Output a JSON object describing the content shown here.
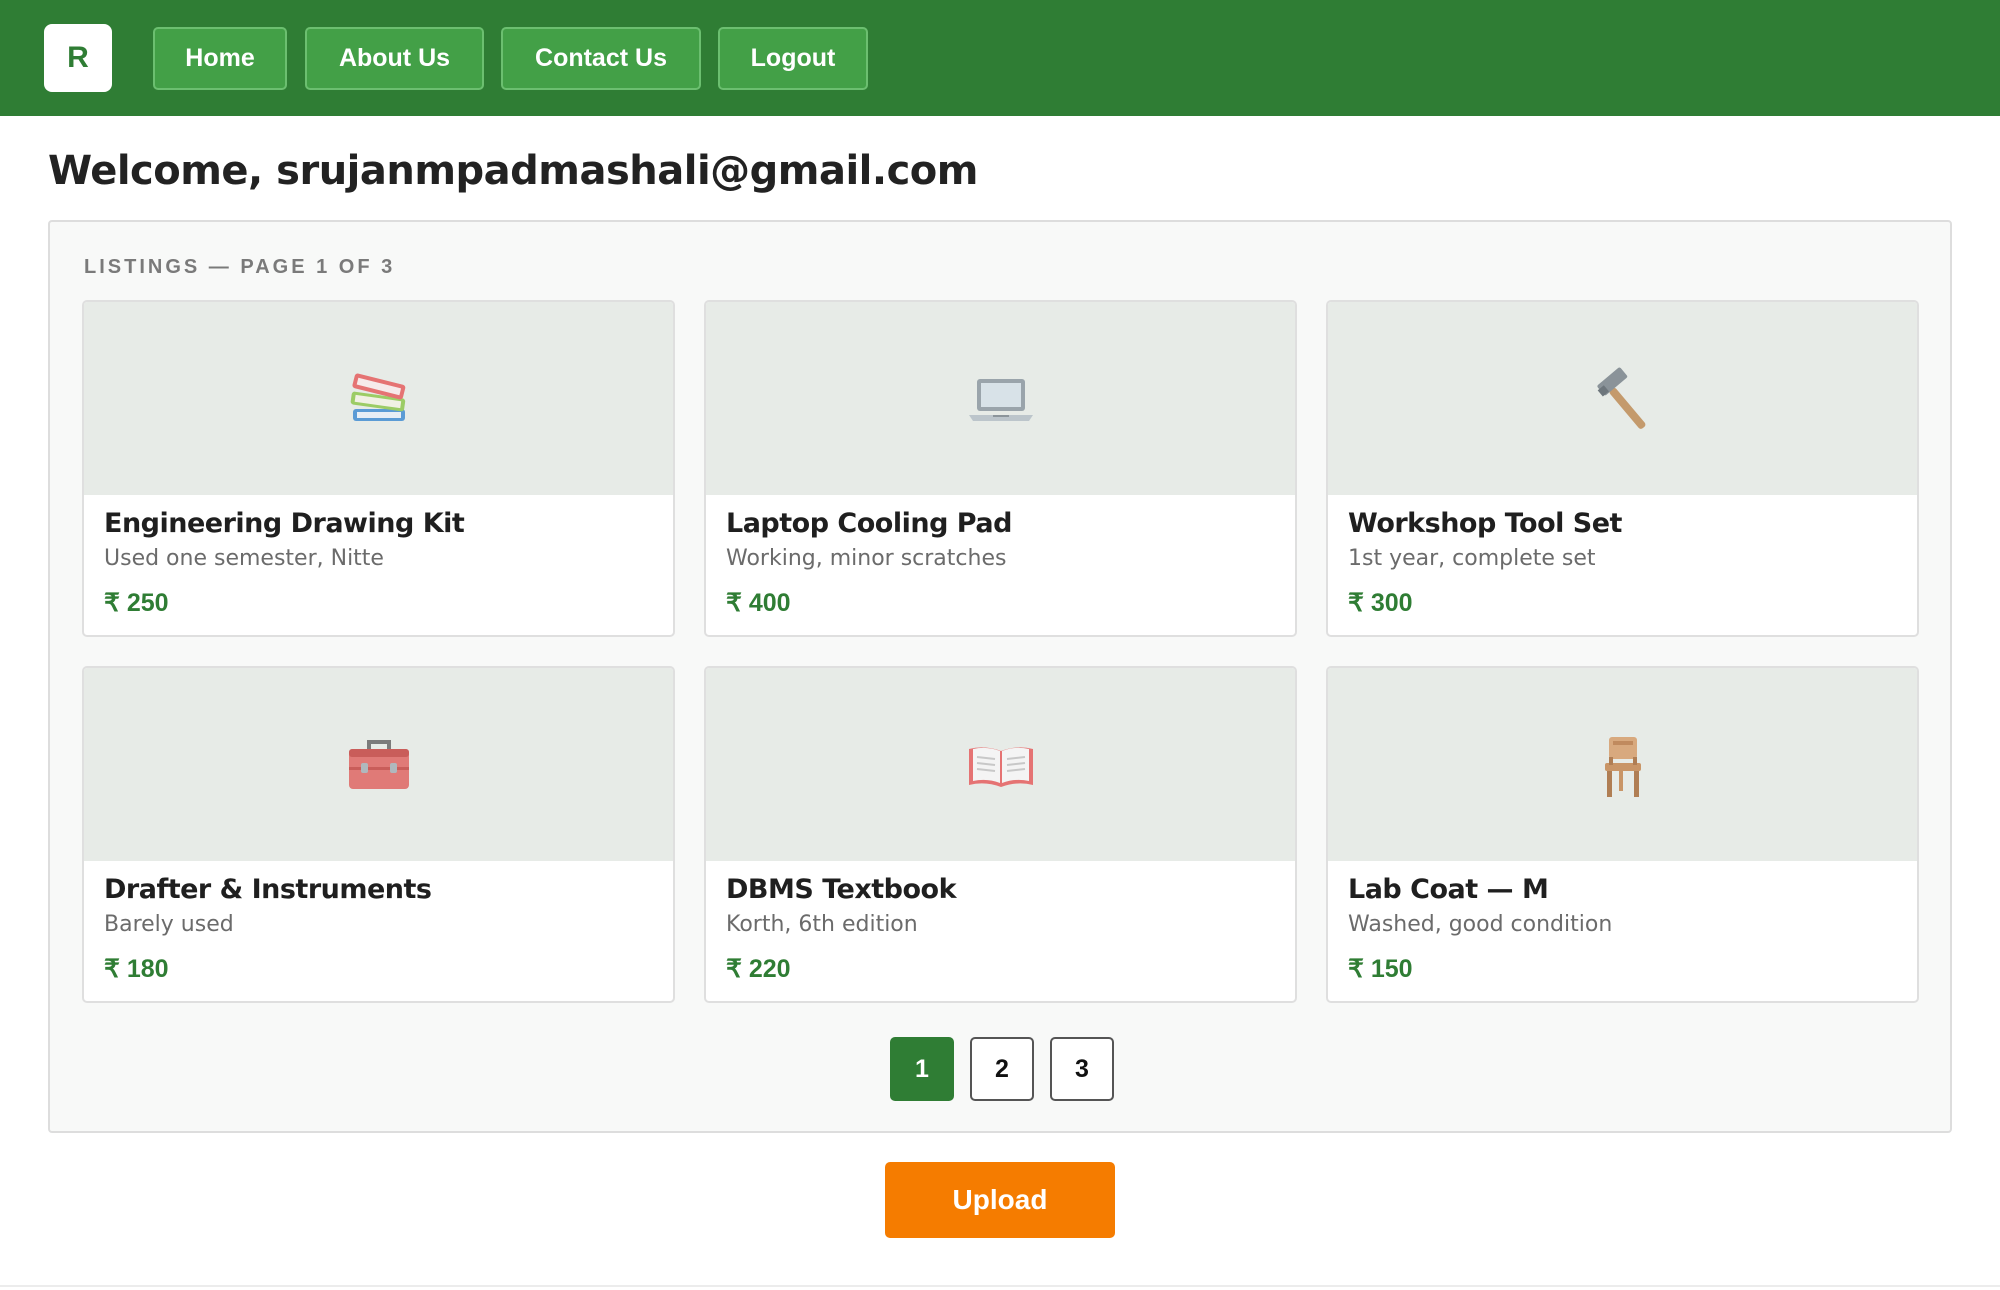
{
  "header": {
    "logo_letter": "R",
    "nav": {
      "home": "Home",
      "about": "About Us",
      "contact": "Contact Us",
      "logout": "Logout"
    }
  },
  "welcome_text": "Welcome, srujanmpadmashali@gmail.com",
  "listings": {
    "heading": "LISTINGS — PAGE 1 OF 3",
    "items": [
      {
        "title": "Engineering Drawing Kit",
        "description": "Used one semester, Nitte",
        "price": "₹ 250",
        "icon": "books-icon"
      },
      {
        "title": "Laptop Cooling Pad",
        "description": "Working, minor scratches",
        "price": "₹ 400",
        "icon": "laptop-icon"
      },
      {
        "title": "Workshop Tool Set",
        "description": "1st year, complete set",
        "price": "₹ 300",
        "icon": "hammer-icon"
      },
      {
        "title": "Drafter & Instruments",
        "description": "Barely used",
        "price": "₹ 180",
        "icon": "toolbox-icon"
      },
      {
        "title": "DBMS Textbook",
        "description": "Korth, 6th edition",
        "price": "₹ 220",
        "icon": "open-book-icon"
      },
      {
        "title": "Lab Coat — M",
        "description": "Washed, good condition",
        "price": "₹ 150",
        "icon": "chair-icon"
      }
    ]
  },
  "pagination": {
    "pages": [
      "1",
      "2",
      "3"
    ],
    "current": "1"
  },
  "upload_label": "Upload",
  "colors": {
    "brand_green": "#2f7d34",
    "nav_button": "#43a047",
    "upload_orange": "#f57c00",
    "price_green": "#2f7d34"
  }
}
